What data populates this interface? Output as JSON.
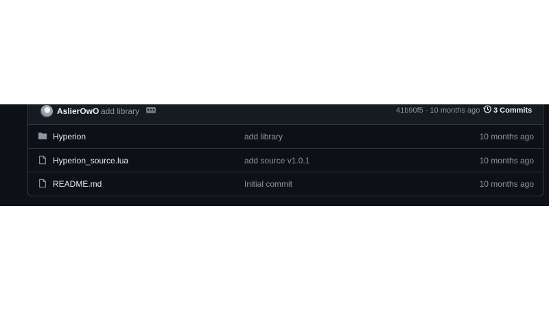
{
  "latest_commit": {
    "author": "AslierOwO",
    "message": "add library",
    "hash_and_time": "41b90f5 · 10 months ago",
    "commits_label": "3 Commits",
    "icons": [
      "avatar",
      "ellipsis-icon",
      "history-icon"
    ]
  },
  "files": [
    {
      "name": "Hyperion",
      "type": "folder",
      "icon": "folder-icon",
      "message": "add library",
      "date": "10 months ago"
    },
    {
      "name": "Hyperion_source.lua",
      "type": "file",
      "icon": "file-icon",
      "message": "add source v1.0.1",
      "date": "10 months ago"
    },
    {
      "name": "README.md",
      "type": "file",
      "icon": "file-icon",
      "message": "Initial commit",
      "date": "10 months ago"
    }
  ],
  "colors": {
    "background": "#0d1117",
    "header": "#161b22",
    "border": "#30363d",
    "text": "#e6edf3",
    "muted": "#8d96a0"
  }
}
